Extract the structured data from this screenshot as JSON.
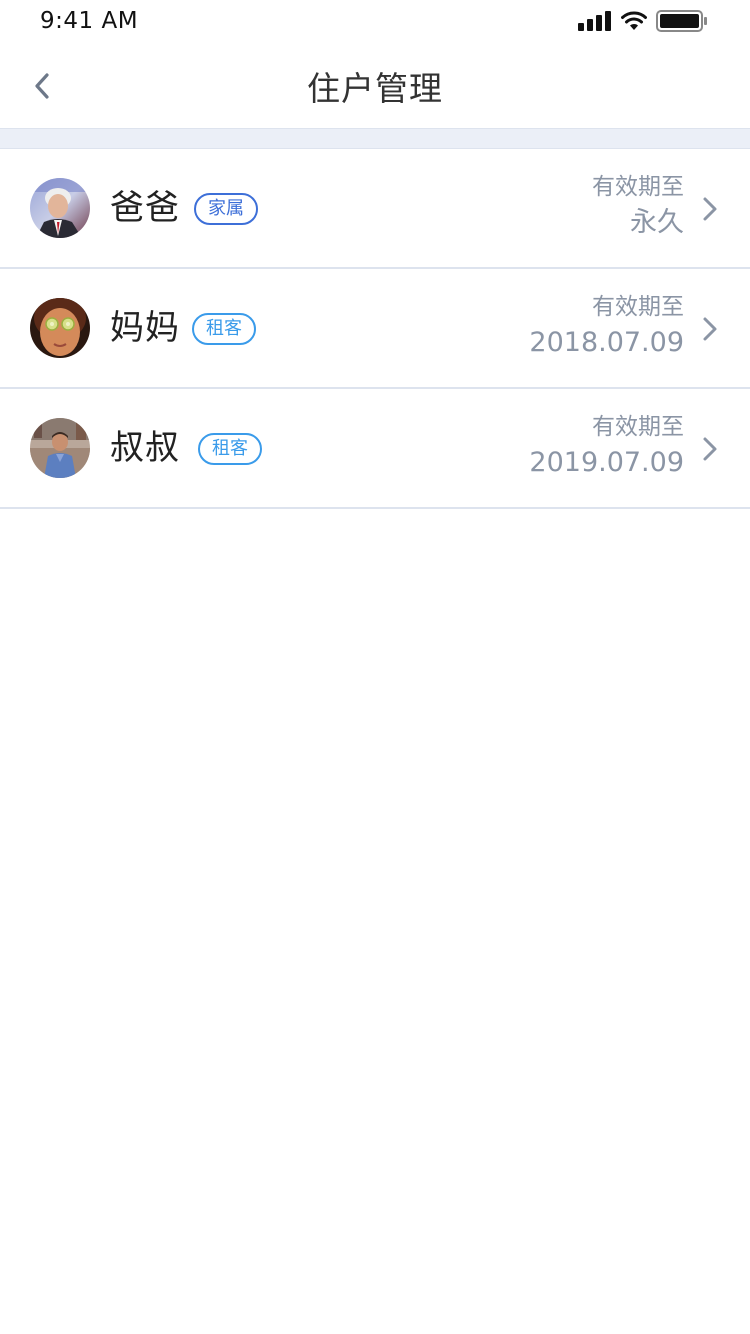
{
  "status_bar": {
    "time": "9:41 AM"
  },
  "nav": {
    "title": "住户管理",
    "back_icon": "chevron-left-icon"
  },
  "colors": {
    "tag_family": "#3d6fd8",
    "tag_renter": "#3a9bea",
    "secondary_text": "#8b95a5",
    "separator": "#dde3ee",
    "band": "#ebeff7"
  },
  "residents": [
    {
      "name": "爸爸",
      "tag": "家属",
      "tag_type": "family",
      "valid_label": "有效期至",
      "valid_value": "永久"
    },
    {
      "name": "妈妈",
      "tag": "租客",
      "tag_type": "renter",
      "valid_label": "有效期至",
      "valid_value": "2018.07.09"
    },
    {
      "name": "叔叔",
      "tag": "租客",
      "tag_type": "renter",
      "valid_label": "有效期至",
      "valid_value": "2019.07.09"
    }
  ]
}
